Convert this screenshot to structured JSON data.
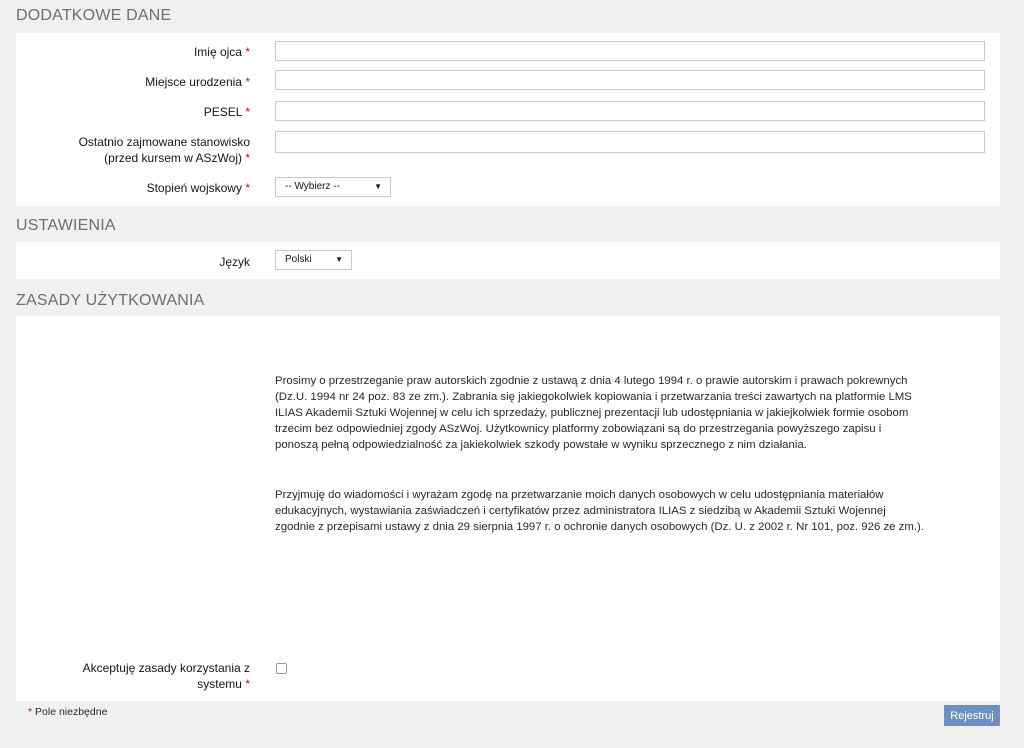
{
  "sections": {
    "extra": "DODATKOWE DANE",
    "settings": "USTAWIENIA",
    "terms": "ZASADY UŻYTKOWANIA"
  },
  "fields": {
    "father_name": {
      "label": "Imię ojca",
      "required": "*",
      "value": ""
    },
    "birthplace": {
      "label": "Miejsce urodzenia",
      "required": "*",
      "value": ""
    },
    "pesel": {
      "label": "PESEL",
      "required": "*",
      "value": ""
    },
    "last_position": {
      "label_line1": "Ostatnio zajmowane stanowisko",
      "label_line2": "(przed kursem w ASzWoj)",
      "required": "*",
      "value": ""
    },
    "rank": {
      "label": "Stopień wojskowy",
      "required": "*",
      "selected": "-- Wybierz --"
    }
  },
  "settings": {
    "language_label": "Język",
    "language_selected": "Polski"
  },
  "terms": {
    "paragraph1_lines": [
      "Prosimy o przestrzeganie praw autorskich zgodnie z ustawą z dnia 4 lutego 1994 r. o prawie autorskim i prawach pokrewnych",
      "(Dz.U. 1994 nr 24 poz. 83 ze zm.). Zabrania się jakiegokolwiek kopiowania i przetwarzania treści zawartych na platformie LMS",
      "ILIAS Akademii Sztuki Wojennej w celu ich sprzedaży, publicznej prezentacji lub udostępniania w jakiejkolwiek formie osobom",
      "trzecim bez odpowiedniej zgody ASzWoj. Użytkownicy platformy zobowiązani są do przestrzegania powyższego zapisu i",
      "ponoszą pełną odpowiedzialność za jakiekolwiek szkody powstałe w wyniku sprzecznego z nim działania."
    ],
    "paragraph2_lines": [
      "Przyjmuję do wiadomości i wyrażam zgodę na przetwarzanie moich danych osobowych w celu udostępniania materiałów",
      "edukacyjnych, wystawiania zaświadczeń i certyfikatów przez administratora ILIAS z siedzibą w Akademii Sztuki Wojennej",
      "zgodnie z przepisami ustawy z dnia 29 sierpnia 1997 r. o ochronie danych osobowych (Dz. U. z 2002 r. Nr 101, poz. 926 ze zm.)."
    ],
    "accept_label_line1": "Akceptuję zasady korzystania z",
    "accept_label_line2": "systemu",
    "required": "*",
    "accepted": false
  },
  "footer": {
    "required_marker": "*",
    "required_note": "Pole niezbędne",
    "submit_label": "Rejestruj"
  },
  "colors": {
    "background": "#f0f0f0",
    "panel": "#ffffff",
    "required": "#c81010",
    "submit_button": "#6f8fbf"
  },
  "icons": {
    "dropdown": "caret-down-icon"
  }
}
